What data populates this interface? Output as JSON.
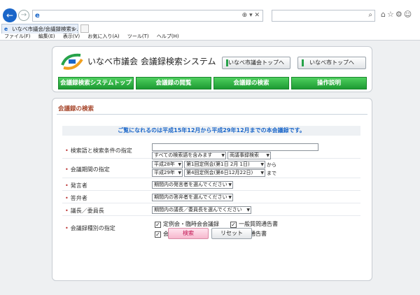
{
  "browser": {
    "tab_title": "いなべ市議会/会議録検索シ...",
    "address_tools": "⊕ ▾ ✕",
    "menu": [
      "ファイル(F)",
      "編集(E)",
      "表示(V)",
      "お気に入り(A)",
      "ツール(T)",
      "ヘルプ(H)"
    ]
  },
  "header": {
    "site_title": "いなべ市議会  会議録検索システム",
    "top_links": [
      "いなべ市議会トップへ",
      "いなべ市トップへ"
    ],
    "global_nav": [
      "会議録検索システムトップ",
      "会議録の閲覧",
      "会議録の検索",
      "操作説明"
    ]
  },
  "content": {
    "section_title": "会議録の検索",
    "notice": "ご覧になれるのは平成15年12月から平成29年12月までの本会議録です。",
    "rows": {
      "keyword": {
        "label": "検索語と検索条件の指定",
        "value": "",
        "option1": "すべての検索語を含みます",
        "option2": "両議事録検索"
      },
      "period": {
        "label": "会議期間の指定",
        "from_year": "平成28年",
        "from_session": "第1回定例会(第1日 2月 1日)",
        "from_suffix": "から",
        "to_year": "平成29年",
        "to_session": "第4回定例会(第6日12月22日)",
        "to_suffix": "まで"
      },
      "speaker": {
        "label": "発言者",
        "value": "期間内の発言者を選んでください"
      },
      "answerer": {
        "label": "答弁者",
        "value": "期間内の答弁者を選んでください"
      },
      "chair": {
        "label": "議長／委員長",
        "value": "期間内の議長／委員長を選んでください"
      },
      "types": {
        "label": "会議録種別の指定",
        "options": [
          "定例会・臨時会会議録",
          "一般質問通告書",
          "会議日程",
          "質疑通告書"
        ],
        "checked": [
          true,
          true,
          true,
          true
        ]
      }
    },
    "buttons": {
      "search": "検索",
      "reset": "リセット"
    }
  },
  "colors": {
    "nav_green": "#27a34a",
    "title_brown": "#a6462b",
    "notice_blue": "#1a66c9",
    "search_pink": "#f6b7cd"
  }
}
